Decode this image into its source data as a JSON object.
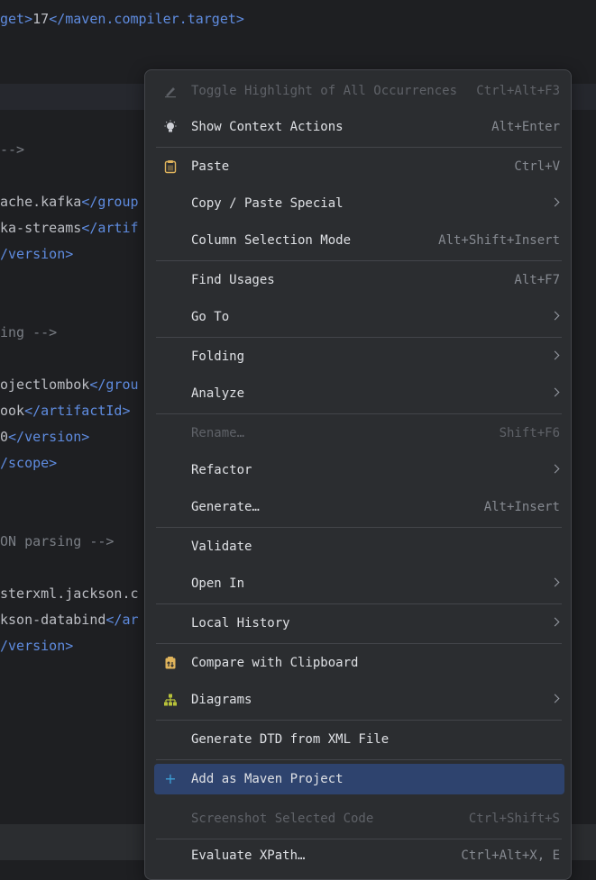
{
  "editor": {
    "lines": [
      {
        "parts": [
          {
            "t": "get>",
            "c": "tag"
          },
          {
            "t": "17",
            "c": "txt"
          },
          {
            "t": "</maven.compiler.target>",
            "c": "tag"
          }
        ]
      },
      {
        "parts": [
          {
            "t": "-->",
            "c": "cmt"
          }
        ]
      },
      {
        "parts": [
          {
            "t": "ache.kafka",
            "c": "txt"
          },
          {
            "t": "</group",
            "c": "tag"
          }
        ]
      },
      {
        "parts": [
          {
            "t": "ka-streams",
            "c": "txt"
          },
          {
            "t": "</artif",
            "c": "tag"
          }
        ]
      },
      {
        "parts": [
          {
            "t": "/version>",
            "c": "tag"
          }
        ]
      },
      {
        "parts": [
          {
            "t": "ing -->",
            "c": "cmt"
          }
        ]
      },
      {
        "parts": [
          {
            "t": "ojectlombok",
            "c": "txt"
          },
          {
            "t": "</grou",
            "c": "tag"
          }
        ]
      },
      {
        "parts": [
          {
            "t": "ook",
            "c": "txt"
          },
          {
            "t": "</artifactId>",
            "c": "tag"
          }
        ]
      },
      {
        "parts": [
          {
            "t": "0",
            "c": "txt"
          },
          {
            "t": "</version>",
            "c": "tag"
          }
        ]
      },
      {
        "parts": [
          {
            "t": "/scope>",
            "c": "tag"
          }
        ]
      },
      {
        "parts": [
          {
            "t": "ON parsing -->",
            "c": "cmt"
          }
        ]
      },
      {
        "parts": [
          {
            "t": "sterxml.jackson.c",
            "c": "txt"
          }
        ]
      },
      {
        "parts": [
          {
            "t": "kson-databind",
            "c": "txt"
          },
          {
            "t": "</ar",
            "c": "tag"
          }
        ]
      },
      {
        "parts": [
          {
            "t": "/version>",
            "c": "tag"
          }
        ]
      }
    ]
  },
  "menu": {
    "items": [
      {
        "label": "Toggle Highlight of All Occurrences",
        "shortcut": "Ctrl+Alt+F3",
        "icon": "highlighter-icon",
        "disabled": true
      },
      {
        "label": "Show Context Actions",
        "shortcut": "Alt+Enter",
        "icon": "lightbulb-icon"
      },
      {
        "label": "Paste",
        "shortcut": "Ctrl+V",
        "icon": "clipboard-icon"
      },
      {
        "label": "Copy / Paste Special",
        "submenu": true
      },
      {
        "label": "Column Selection Mode",
        "shortcut": "Alt+Shift+Insert"
      },
      {
        "label": "Find Usages",
        "shortcut": "Alt+F7"
      },
      {
        "label": "Go To",
        "submenu": true
      },
      {
        "label": "Folding",
        "submenu": true
      },
      {
        "label": "Analyze",
        "submenu": true
      },
      {
        "label": "Rename…",
        "shortcut": "Shift+F6",
        "disabled": true
      },
      {
        "label": "Refactor",
        "submenu": true
      },
      {
        "label": "Generate…",
        "shortcut": "Alt+Insert"
      },
      {
        "label": "Validate"
      },
      {
        "label": "Open In",
        "submenu": true
      },
      {
        "label": "Local History",
        "submenu": true
      },
      {
        "label": "Compare with Clipboard",
        "icon": "compare-clipboard-icon"
      },
      {
        "label": "Diagrams",
        "submenu": true,
        "icon": "diagram-icon"
      },
      {
        "label": "Generate DTD from XML File"
      },
      {
        "label": "Add as Maven Project",
        "icon": "plus-icon",
        "selected": true
      },
      {
        "label": "Screenshot Selected Code",
        "shortcut": "Ctrl+Shift+S",
        "disabled": true
      },
      {
        "label": "Evaluate XPath…",
        "shortcut": "Ctrl+Alt+X, E"
      }
    ]
  },
  "colors": {
    "editor_bg": "#1e1f22",
    "menu_bg": "#2b2d30",
    "selection": "#2e436e",
    "tag": "#5f8ce0",
    "accent_plus": "#3d9fd6",
    "clipboard_icon": "#e0b45c",
    "diagram_icon": "#b8c23a"
  }
}
